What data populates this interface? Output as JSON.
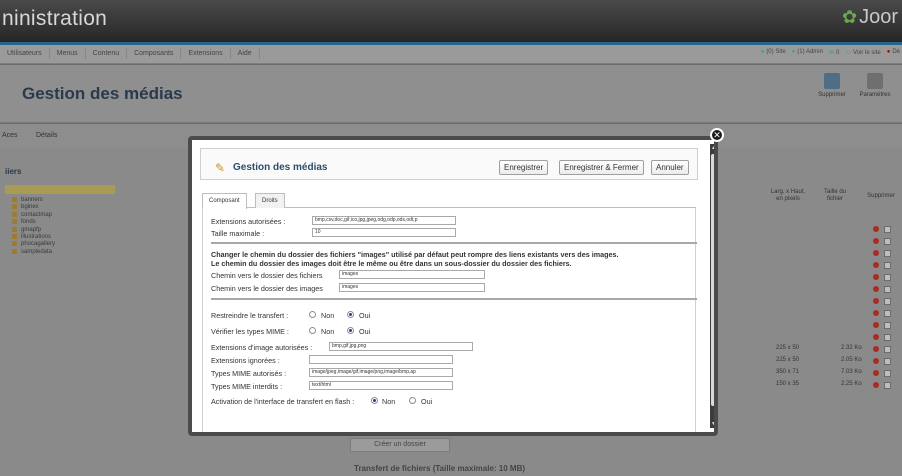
{
  "app": {
    "title": "ninistration",
    "logo_text": "Joor"
  },
  "menu": [
    "Utilisateurs",
    "Menus",
    "Contenu",
    "Composants",
    "Extensions",
    "Aide"
  ],
  "status_bar": [
    "(0) Site",
    "(1) Admin",
    "0",
    "Voir le site",
    "Dé"
  ],
  "page": {
    "title": "Gestion des médias",
    "toolbar": [
      "Supprimer",
      "Paramètres"
    ],
    "tabs": [
      "Aces",
      "Détails"
    ],
    "folders_title": "iiers",
    "folders": [
      "banners",
      "bginex",
      "contactmap",
      "fonds",
      "gmapfp",
      "illustrations",
      "phocagallery",
      "sampledata"
    ]
  },
  "table": {
    "headers": [
      "Larg. x Haut. en pixels",
      "Taille du fichier",
      "Supprimer"
    ],
    "rows": [
      {
        "dimensions": "225 x 50",
        "size": "2.32 Ko"
      },
      {
        "dimensions": "225 x 50",
        "size": "2.05 Ko"
      },
      {
        "dimensions": "350 x 71",
        "size": "7.03 Ko"
      },
      {
        "dimensions": "150 x 35",
        "size": "2.25 Ko"
      }
    ]
  },
  "bottom": {
    "create_folder": "Créer un dossier",
    "upload_title": "Transfert de fichiers (Taille maximale: 10 MB)"
  },
  "modal": {
    "title": "Gestion des médias",
    "buttons": {
      "save": "Enregistrer",
      "save_close": "Enregistrer & Fermer",
      "cancel": "Annuler"
    },
    "tabs": [
      "Composant",
      "Droits"
    ],
    "fields": {
      "ext_label": "Extensions autorisées :",
      "ext_value": "bmp,csv,doc,gif,ico,jpg,jpeg,odg,odp,ods,odt,p",
      "max_size_label": "Taille maximale :",
      "max_size_value": "10",
      "desc1": "Changer le chemin du dossier des fichiers \"images\" utilisé par défaut peut rompre des liens existants vers des images.",
      "desc2": "Le chemin du dossier des images doit être le même ou être dans un sous-dossier du dossier des fichiers.",
      "file_path_label": "Chemin vers le dossier des fichiers",
      "file_path_value": "images",
      "image_path_label": "Chemin vers le dossier des images",
      "image_path_value": "images",
      "restrict_label": "Restreindre le transfert :",
      "mime_check_label": "Vérifier les types MIME :",
      "no": "Non",
      "yes": "Oui",
      "img_ext_label": "Extensions d'image autorisées :",
      "img_ext_value": "bmp,gif,jpg,png",
      "ignored_label": "Extensions ignorées :",
      "ignored_value": "",
      "mime_allowed_label": "Types MIME autorisés :",
      "mime_allowed_value": "image/jpeg,image/gif,image/png,image/bmp,ap",
      "mime_forbidden_label": "Types MIME interdits :",
      "mime_forbidden_value": "text/html",
      "flash_label": "Activation de l'interface de transfert en flash :"
    },
    "radios": {
      "restrict": "Oui",
      "mime_check": "Oui",
      "flash": "Non"
    }
  }
}
